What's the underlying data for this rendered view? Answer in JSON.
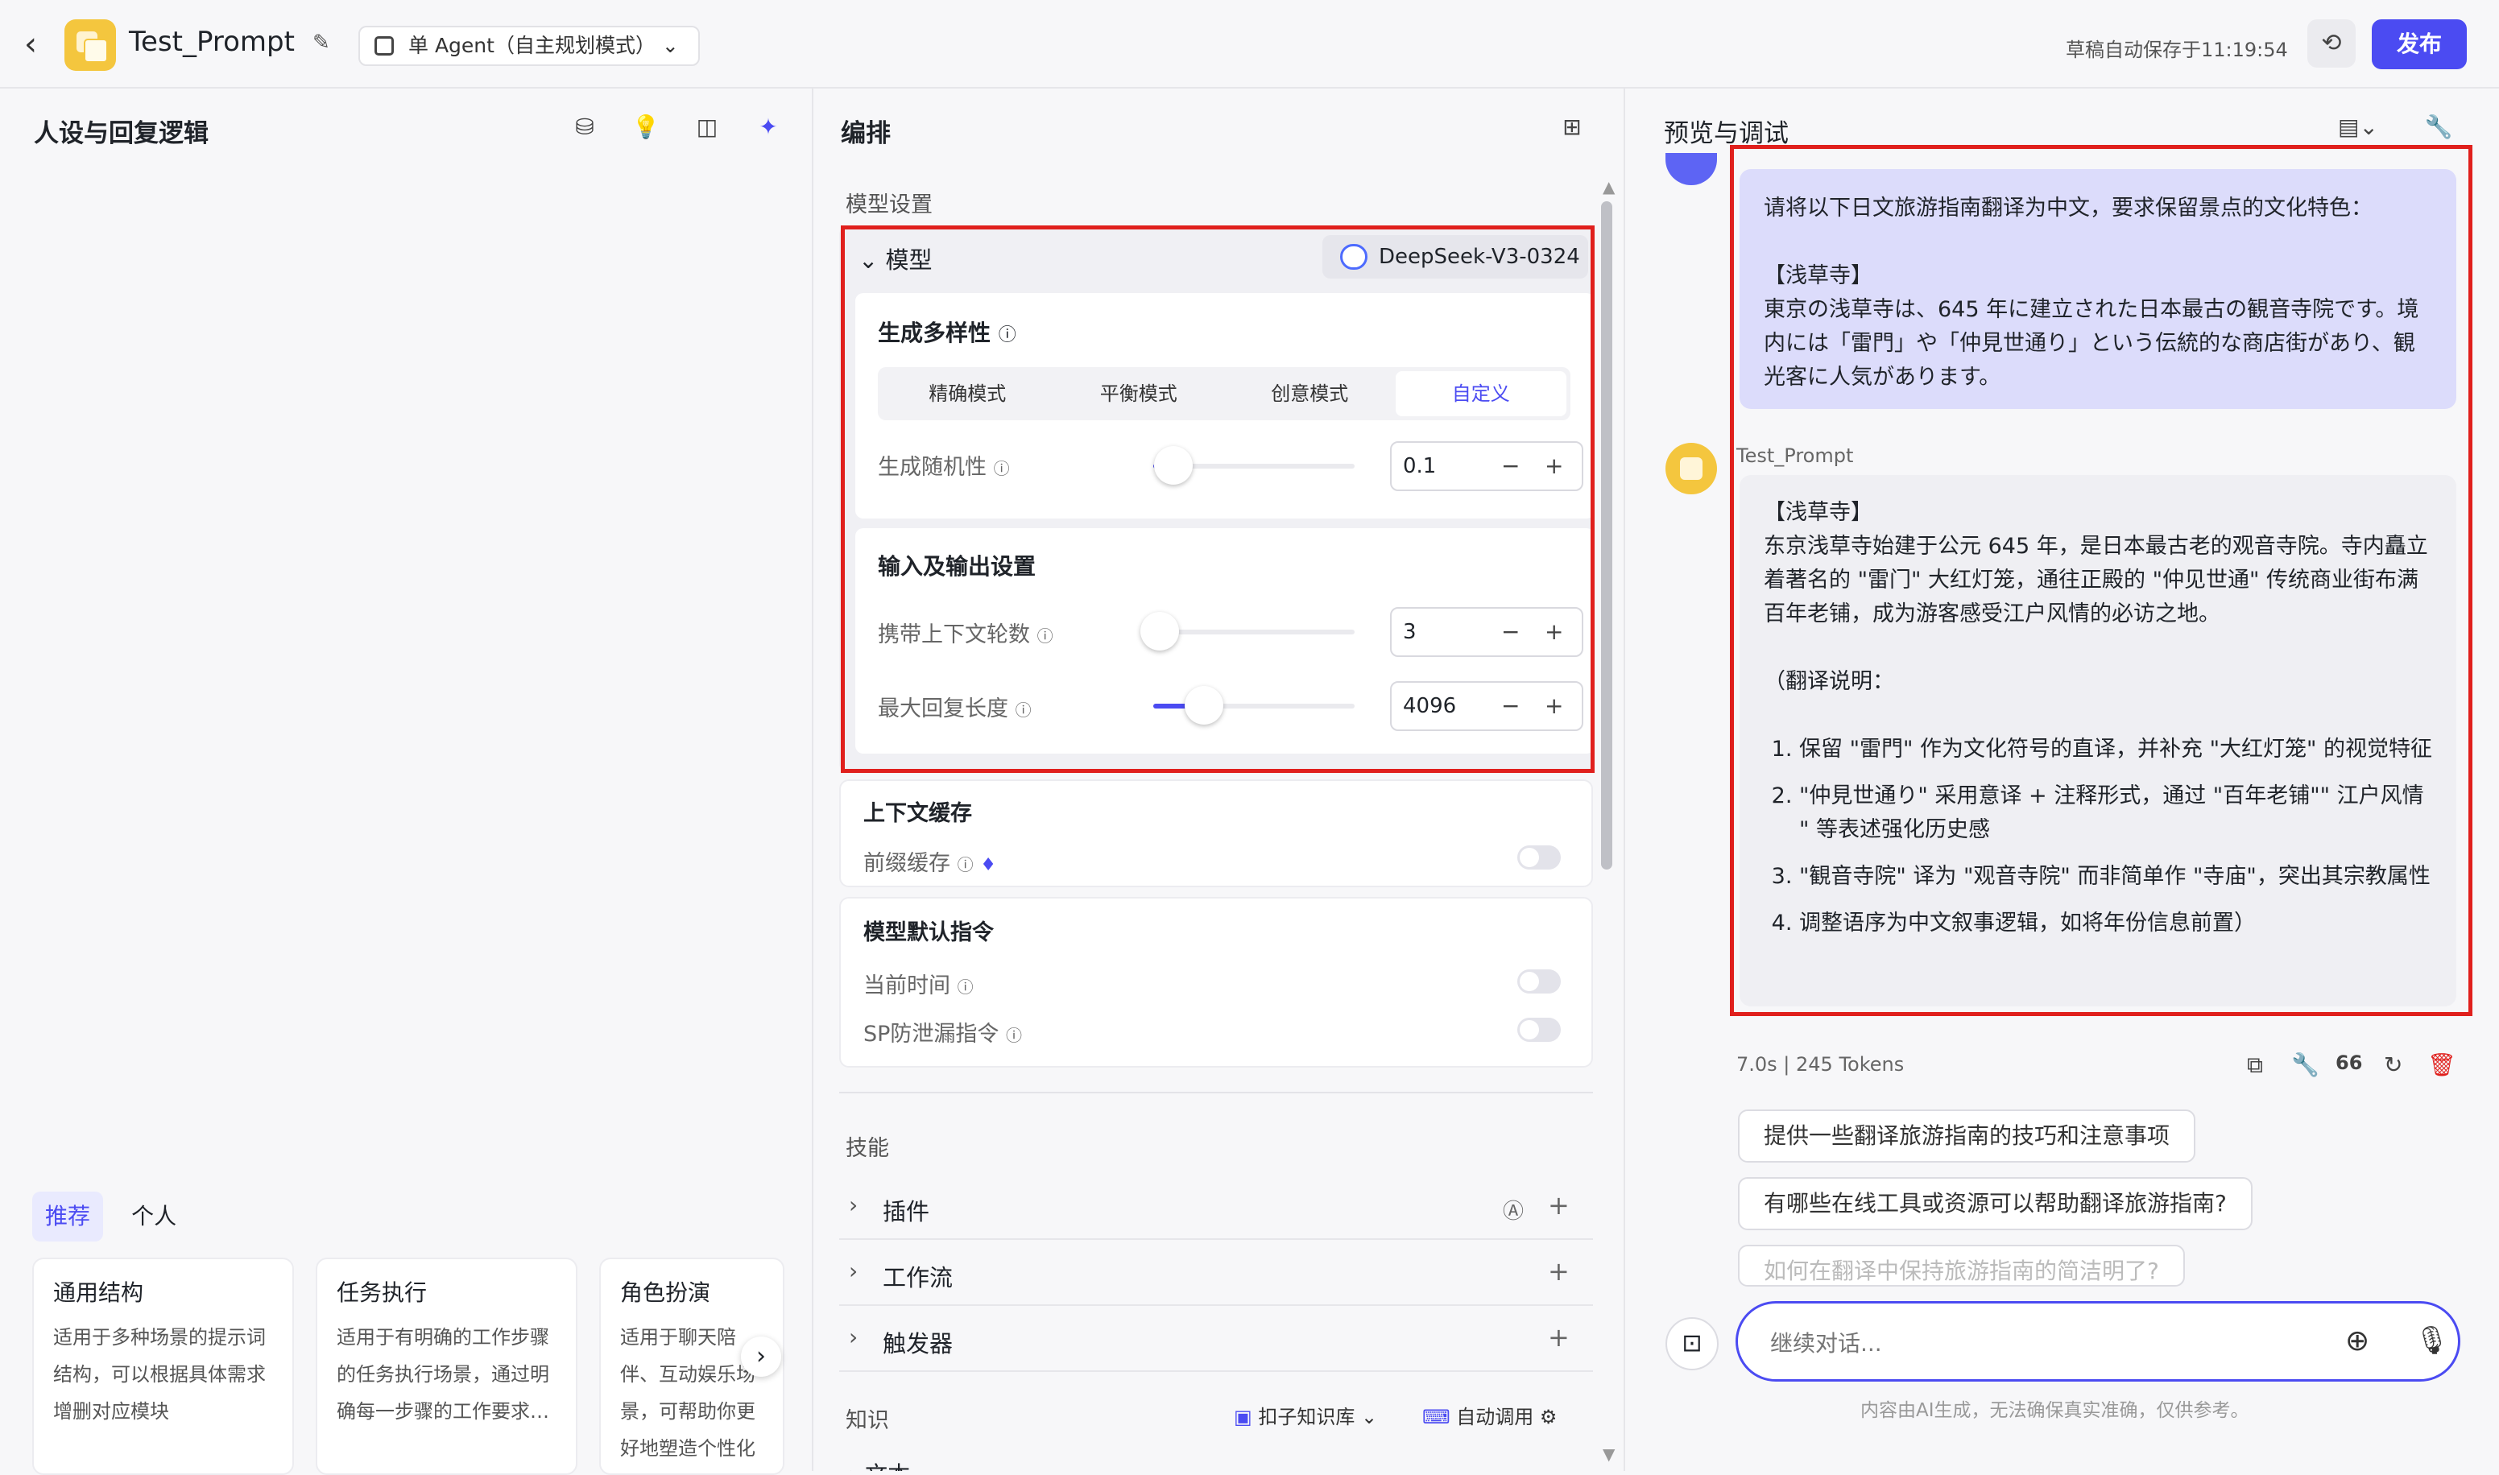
{
  "topbar": {
    "back_icon": "chevron-left-icon",
    "app_title": "Test_Prompt",
    "mode": "单 Agent（自主规划模式）",
    "saved_text": "草稿自动保存于11:19:54",
    "publish_label": "发布"
  },
  "left_panel": {
    "title": "人设与回复逻辑",
    "tabs": [
      "推荐",
      "个人"
    ],
    "cards": [
      {
        "title": "通用结构",
        "desc": "适用于多种场景的提示词结构，可以根据具体需求增删对应模块"
      },
      {
        "title": "任务执行",
        "desc": "适用于有明确的工作步骤的任务执行场景，通过明确每一步骤的工作要求…"
      },
      {
        "title": "角色扮演",
        "desc": "适用于聊天陪伴、互动娱乐场景，可帮助你更好地塑造个性化的人物"
      }
    ]
  },
  "mid_panel": {
    "title": "编排",
    "model_settings_label": "模型设置",
    "model_label": "模型",
    "model_name": "DeepSeek-V3-0324",
    "diversity_title": "生成多样性",
    "modes": [
      "精确模式",
      "平衡模式",
      "创意模式",
      "自定义"
    ],
    "active_mode": "自定义",
    "randomness_label": "生成随机性",
    "randomness_value": "0.1",
    "randomness_fraction": 0.1,
    "io_title": "输入及输出设置",
    "context_rounds_label": "携带上下文轮数",
    "context_rounds_value": "3",
    "context_rounds_fraction": 0.03,
    "max_len_label": "最大回复长度",
    "max_len_value": "4096",
    "max_len_fraction": 0.25,
    "cache_title": "上下文缓存",
    "prefix_cache_label": "前缀缓存",
    "default_instr_title": "模型默认指令",
    "current_time_label": "当前时间",
    "sp_leak_label": "SP防泄漏指令",
    "skills_label": "技能",
    "skills": [
      "插件",
      "工作流",
      "触发器"
    ],
    "knowledge_label": "知识",
    "kb_label": "扣子知识库",
    "auto_call_label": "自动调用",
    "text_label": "文本"
  },
  "right_panel": {
    "title": "预览与调试",
    "user_message": [
      "请将以下日文旅游指南翻译为中文，要求保留景点的文化特色：",
      "",
      "【浅草寺】",
      "東京の浅草寺は、645 年に建立された日本最古の観音寺院です。境内には「雷門」や「仲見世通り」という伝統的な商店街があり、観光客に人気があります。"
    ],
    "bot_name": "Test_Prompt",
    "bot_message": {
      "heading": "【浅草寺】",
      "body": "东京浅草寺始建于公元 645 年，是日本最古老的观音寺院。寺内矗立着著名的 \"雷门\" 大红灯笼，通往正殿的 \"仲见世通\" 传统商业街布满百年老铺，成为游客感受江户风情的必访之地。",
      "note_title": "（翻译说明：",
      "notes": [
        "保留 \"雷門\" 作为文化符号的直译，并补充 \"大红灯笼\" 的视觉特征",
        "\"仲見世通り\" 采用意译 + 注释形式，通过 \"百年老铺\"\" 江户风情 \" 等表述强化历史感",
        "\"観音寺院\" 译为 \"观音寺院\" 而非简单作 \"寺庙\"，突出其宗教属性",
        "调整语序为中文叙事逻辑，如将年份信息前置）"
      ]
    },
    "meta_time": "7.0s",
    "meta_tokens": "245 Tokens",
    "suggestions": [
      "提供一些翻译旅游指南的技巧和注意事项",
      "有哪些在线工具或资源可以帮助翻译旅游指南?",
      "如何在翻译中保持旅游指南的简洁明了?"
    ],
    "input_placeholder": "继续对话...",
    "disclaimer": "内容由AI生成，无法确保真实准确，仅供参考。"
  },
  "colors": {
    "accent": "#4b4bf2",
    "highlight_box": "#e0201d",
    "user_bubble": "#dcdcfb"
  }
}
